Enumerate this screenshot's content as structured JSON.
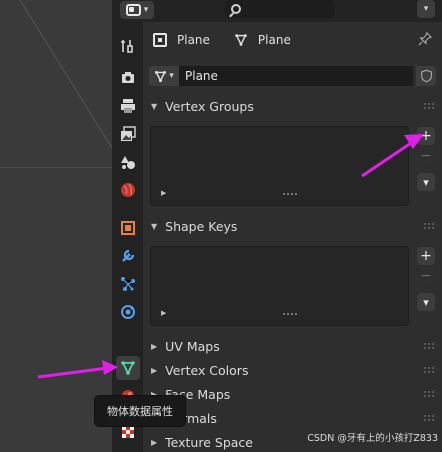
{
  "header": {
    "editor_type_icon": "properties-editor-icon",
    "search_placeholder": "",
    "options_icon": "chevron-down-icon"
  },
  "context": {
    "object_name": "Plane",
    "data_name": "Plane",
    "pin_icon": "pin-icon"
  },
  "mesh": {
    "name": "Plane",
    "fake_user_icon": "shield-icon"
  },
  "panels": {
    "vertex_groups": "Vertex Groups",
    "shape_keys": "Shape Keys",
    "uv_maps": "UV Maps",
    "vertex_colors": "Vertex Colors",
    "face_maps": "Face Maps",
    "normals": "Normals",
    "texture_space": "Texture Space"
  },
  "buttons": {
    "add": "+",
    "remove": "−",
    "specials": "⌄"
  },
  "tabs": [
    {
      "name": "tool-tab",
      "icon": "wrench-screwdriver-icon"
    },
    {
      "name": "render-tab",
      "icon": "camera-back-icon"
    },
    {
      "name": "output-tab",
      "icon": "printer-icon"
    },
    {
      "name": "view-layer-tab",
      "icon": "images-icon"
    },
    {
      "name": "scene-tab",
      "icon": "scene-shapes-icon"
    },
    {
      "name": "world-tab",
      "icon": "globe-icon"
    },
    {
      "name": "object-tab",
      "icon": "object-square-icon"
    },
    {
      "name": "modifiers-tab",
      "icon": "wrench-icon"
    },
    {
      "name": "particles-tab",
      "icon": "particles-icon"
    },
    {
      "name": "physics-tab",
      "icon": "physics-orbit-icon"
    },
    {
      "name": "object-data-tab",
      "icon": "mesh-triangle-icon"
    },
    {
      "name": "material-tab",
      "icon": "material-sphere-icon"
    },
    {
      "name": "texture-tab",
      "icon": "checker-icon"
    }
  ],
  "tooltip": "物体数据属性",
  "watermark": "CSDN @牙有上的小孩打Z833",
  "colors": {
    "annotation_arrow": "#e020e8",
    "active_tab_icon": "#52d6a6"
  }
}
